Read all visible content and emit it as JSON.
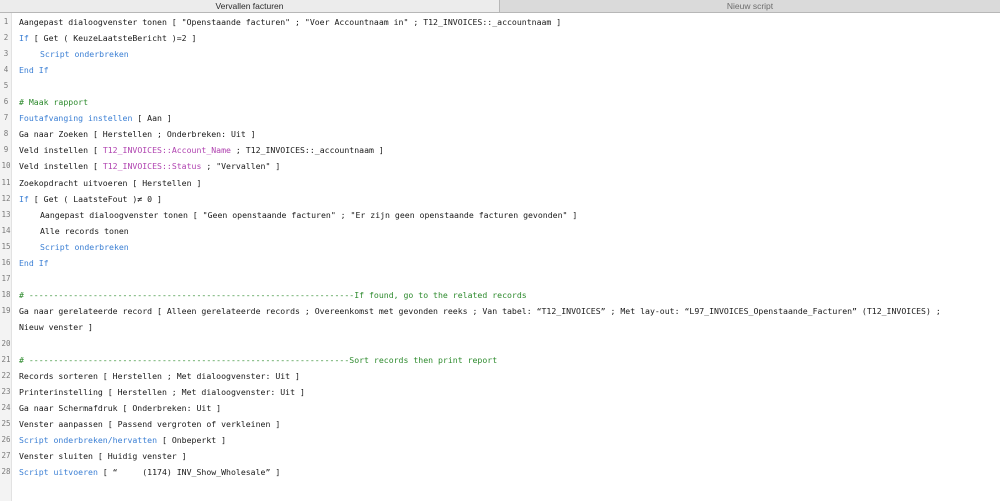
{
  "tabs": [
    {
      "label": "Vervallen facturen",
      "active": true
    },
    {
      "label": "Nieuw script",
      "active": false
    }
  ],
  "colors": {
    "keyword": "#3b7fd4",
    "field": "#b043b0",
    "comment": "#2e8b2e"
  },
  "lines": [
    {
      "num": "1",
      "indent": 0,
      "segments": [
        {
          "t": "Aangepast dialoogvenster tonen [ \"Openstaande facturen\" ; \"Voer Accountnaam in\" ; T12_INVOICES::_accountnaam ]",
          "c": "plain"
        }
      ]
    },
    {
      "num": "2",
      "indent": 0,
      "segments": [
        {
          "t": "If",
          "c": "kw"
        },
        {
          "t": " [ Get ( KeuzeLaatsteBericht )=2 ]",
          "c": "plain"
        }
      ]
    },
    {
      "num": "3",
      "indent": 1,
      "segments": [
        {
          "t": "Script onderbreken",
          "c": "kw"
        }
      ]
    },
    {
      "num": "4",
      "indent": 0,
      "segments": [
        {
          "t": "End If",
          "c": "kw"
        }
      ]
    },
    {
      "num": "5",
      "indent": 0,
      "segments": []
    },
    {
      "num": "6",
      "indent": 0,
      "segments": [
        {
          "t": "# Maak rapport",
          "c": "cmt"
        }
      ]
    },
    {
      "num": "7",
      "indent": 0,
      "segments": [
        {
          "t": "Foutafvanging instellen",
          "c": "kw"
        },
        {
          "t": " [ Aan ]",
          "c": "plain"
        }
      ]
    },
    {
      "num": "8",
      "indent": 0,
      "segments": [
        {
          "t": "Ga naar Zoeken [ Herstellen ; Onderbreken: Uit ]",
          "c": "plain"
        }
      ]
    },
    {
      "num": "9",
      "indent": 0,
      "segments": [
        {
          "t": "Veld instellen [ ",
          "c": "plain"
        },
        {
          "t": "T12_INVOICES::Account_Name",
          "c": "fld"
        },
        {
          "t": " ; T12_INVOICES::_accountnaam ]",
          "c": "plain"
        }
      ]
    },
    {
      "num": "10",
      "indent": 0,
      "segments": [
        {
          "t": "Veld instellen [ ",
          "c": "plain"
        },
        {
          "t": "T12_INVOICES::Status",
          "c": "fld"
        },
        {
          "t": " ; \"Vervallen\" ]",
          "c": "plain"
        }
      ]
    },
    {
      "num": "11",
      "indent": 0,
      "segments": [
        {
          "t": "Zoekopdracht uitvoeren [ Herstellen ]",
          "c": "plain"
        }
      ]
    },
    {
      "num": "12",
      "indent": 0,
      "segments": [
        {
          "t": "If",
          "c": "kw"
        },
        {
          "t": " [ Get ( LaatsteFout )≠ 0 ]",
          "c": "plain"
        }
      ]
    },
    {
      "num": "13",
      "indent": 1,
      "segments": [
        {
          "t": "Aangepast dialoogvenster tonen [ \"Geen openstaande facturen\" ; \"Er zijn geen openstaande facturen gevonden\" ]",
          "c": "plain"
        }
      ]
    },
    {
      "num": "14",
      "indent": 1,
      "segments": [
        {
          "t": "Alle records tonen",
          "c": "plain"
        }
      ]
    },
    {
      "num": "15",
      "indent": 1,
      "segments": [
        {
          "t": "Script onderbreken",
          "c": "kw"
        }
      ]
    },
    {
      "num": "16",
      "indent": 0,
      "segments": [
        {
          "t": "End If",
          "c": "kw"
        }
      ]
    },
    {
      "num": "17",
      "indent": 0,
      "segments": []
    },
    {
      "num": "18",
      "indent": 0,
      "segments": [
        {
          "t": "# ------------------------------------------------------------------If found, go to the related records",
          "c": "cmt"
        }
      ]
    },
    {
      "num": "19",
      "indent": 0,
      "segments": [
        {
          "t": "Ga naar gerelateerde record [ Alleen gerelateerde records ; Overeenkomst met gevonden reeks ; Van tabel: “T12_INVOICES” ; Met lay-out: “L97_INVOICES_Openstaande_Facturen” (T12_INVOICES) ;",
          "c": "plain"
        }
      ]
    },
    {
      "num": "",
      "indent": 0,
      "segments": [
        {
          "t": "Nieuw venster ]",
          "c": "plain"
        }
      ]
    },
    {
      "num": "20",
      "indent": 0,
      "segments": []
    },
    {
      "num": "21",
      "indent": 0,
      "segments": [
        {
          "t": "# -----------------------------------------------------------------Sort records then print report",
          "c": "cmt"
        }
      ]
    },
    {
      "num": "22",
      "indent": 0,
      "segments": [
        {
          "t": "Records sorteren [ Herstellen ; Met dialoogvenster: Uit ]",
          "c": "plain"
        }
      ]
    },
    {
      "num": "23",
      "indent": 0,
      "segments": [
        {
          "t": "Printerinstelling [ Herstellen ; Met dialoogvenster: Uit ]",
          "c": "plain"
        }
      ]
    },
    {
      "num": "24",
      "indent": 0,
      "segments": [
        {
          "t": "Ga naar Schermafdruk [ Onderbreken: Uit ]",
          "c": "plain"
        }
      ]
    },
    {
      "num": "25",
      "indent": 0,
      "segments": [
        {
          "t": "Venster aanpassen [ Passend vergroten of verkleinen ]",
          "c": "plain"
        }
      ]
    },
    {
      "num": "26",
      "indent": 0,
      "segments": [
        {
          "t": "Script onderbreken/hervatten",
          "c": "kw"
        },
        {
          "t": " [ Onbeperkt ]",
          "c": "plain"
        }
      ]
    },
    {
      "num": "27",
      "indent": 0,
      "segments": [
        {
          "t": "Venster sluiten [ Huidig venster ]",
          "c": "plain"
        }
      ]
    },
    {
      "num": "28",
      "indent": 0,
      "segments": [
        {
          "t": "Script uitvoeren",
          "c": "kw"
        },
        {
          "t": " [ “     (1174) INV_Show_Wholesale” ]",
          "c": "plain"
        }
      ]
    }
  ]
}
